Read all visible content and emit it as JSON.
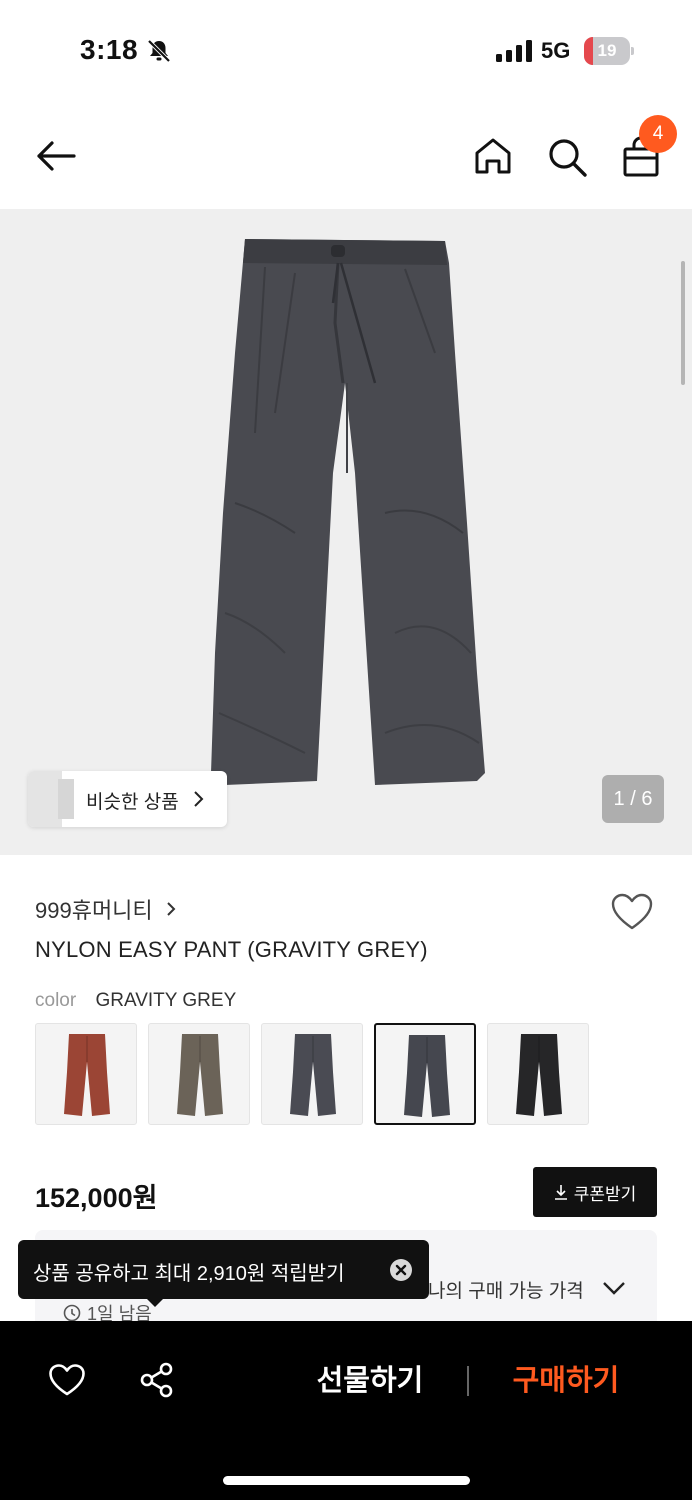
{
  "status_bar": {
    "time": "3:18",
    "network": "5G",
    "battery_level": "19",
    "battery_fraction": 0.19,
    "battery_color": "#e5484d"
  },
  "header": {
    "cart_count": "4",
    "accent_color": "#ff5a1f"
  },
  "gallery": {
    "similar_label": "비슷한 상품",
    "page_indicator": "1 / 6"
  },
  "product": {
    "brand": "999휴머니티",
    "title": "NYLON EASY PANT (GRAVITY GREY)",
    "color_key": "color",
    "color_value": "GRAVITY GREY",
    "swatches": [
      {
        "color": "#9b4535",
        "selected": false
      },
      {
        "color": "#6b6358",
        "selected": false
      },
      {
        "color": "#4a4b53",
        "selected": false
      },
      {
        "color": "#45474f",
        "selected": true
      },
      {
        "color": "#262628",
        "selected": false
      }
    ],
    "price": "152,000원",
    "coupon_label": "쿠폰받기",
    "price_card_label": "나의 구매 가능 가격",
    "timer_text": "1일 남음"
  },
  "tooltip": {
    "text": "상품 공유하고 최대 2,910원 적립받기"
  },
  "bottom_bar": {
    "gift_label": "선물하기",
    "buy_label": "구매하기"
  }
}
